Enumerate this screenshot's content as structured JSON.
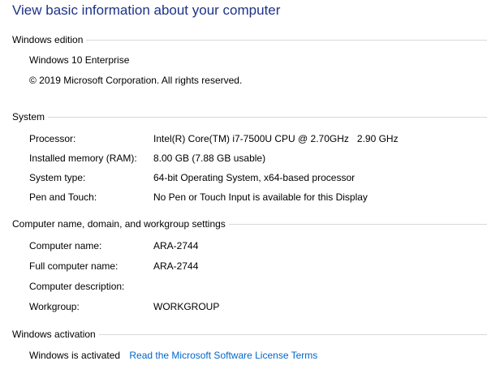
{
  "page_title": "View basic information about your computer",
  "windows_edition": {
    "heading": "Windows edition",
    "edition": "Windows 10 Enterprise",
    "copyright": "© 2019 Microsoft Corporation. All rights reserved."
  },
  "system": {
    "heading": "System",
    "rows": [
      {
        "label": "Processor:",
        "value": "Intel(R) Core(TM) i7-7500U CPU @ 2.70GHz   2.90 GHz"
      },
      {
        "label": "Installed memory (RAM):",
        "value": "8.00 GB (7.88 GB usable)"
      },
      {
        "label": "System type:",
        "value": "64-bit Operating System, x64-based processor"
      },
      {
        "label": "Pen and Touch:",
        "value": "No Pen or Touch Input is available for this Display"
      }
    ]
  },
  "computer_name": {
    "heading": "Computer name, domain, and workgroup settings",
    "rows": [
      {
        "label": "Computer name:",
        "value": "ARA-2744"
      },
      {
        "label": "Full computer name:",
        "value": "ARA-2744"
      },
      {
        "label": "Computer description:",
        "value": ""
      },
      {
        "label": "Workgroup:",
        "value": "WORKGROUP"
      }
    ]
  },
  "activation": {
    "heading": "Windows activation",
    "status": "Windows is activated",
    "license_link": "Read the Microsoft Software License Terms"
  },
  "colors": {
    "title": "#1e3287",
    "link": "#0066cc",
    "divider": "#d9d9d9"
  }
}
